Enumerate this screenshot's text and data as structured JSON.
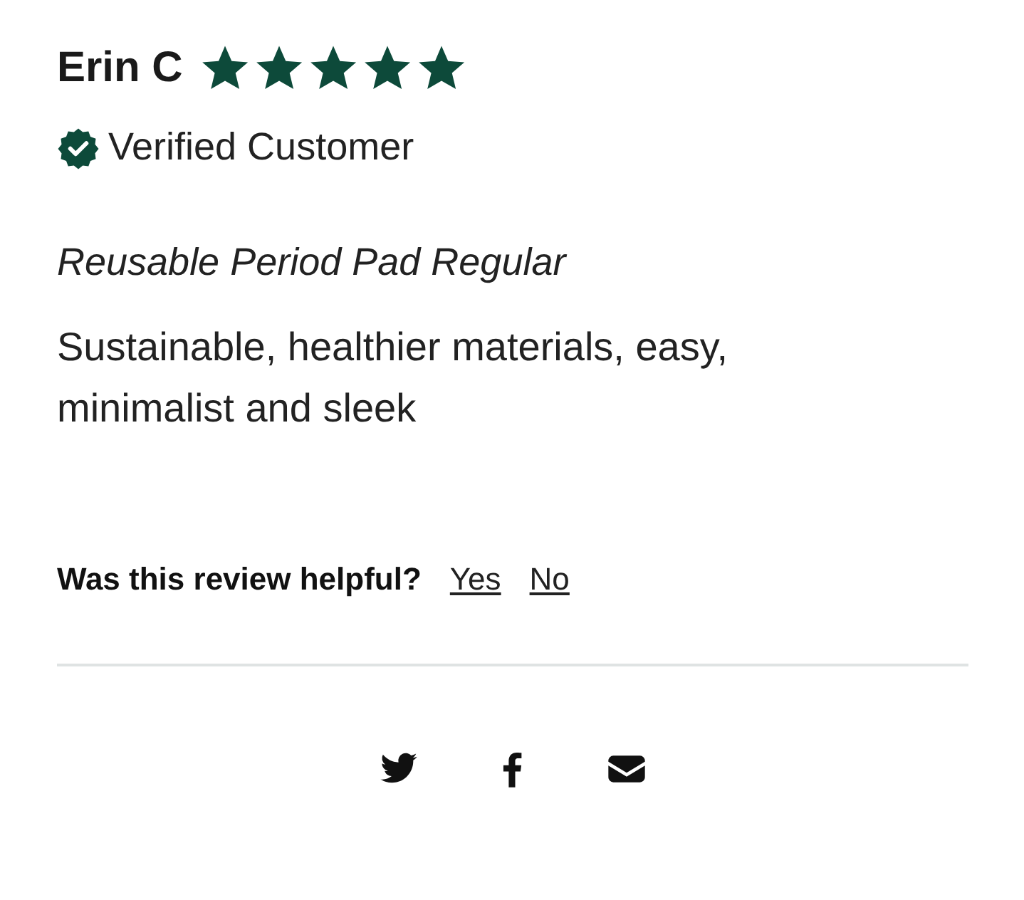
{
  "review": {
    "author": "Erin C",
    "stars": 5,
    "verified_label": "Verified Customer",
    "product": "Reusable Period Pad Regular",
    "body": "Sustainable, healthier materials, easy, minimalist and sleek"
  },
  "helpful": {
    "question": "Was this review helpful?",
    "options": [
      "Yes",
      "No"
    ]
  },
  "share": [
    {
      "kind": "twitter"
    },
    {
      "kind": "facebook"
    },
    {
      "kind": "email"
    }
  ]
}
